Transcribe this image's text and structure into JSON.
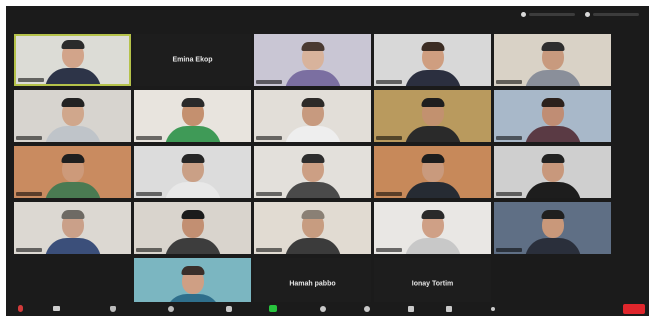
{
  "window": {
    "background": "#1b1b1b",
    "active_border": "#b5c24a"
  },
  "topbar": {
    "items": [
      {
        "icon": "view-icon"
      },
      {
        "icon": "fullscreen-icon"
      }
    ]
  },
  "tiles": [
    {
      "kind": "video",
      "active": true,
      "wall": "#dcdcd6",
      "skin": "#d2a48a",
      "hair": "#2b2b2b",
      "shirt": "#2d3448"
    },
    {
      "kind": "name",
      "name": "Emina Ekop"
    },
    {
      "kind": "video",
      "wall": "#c9c6d4",
      "skin": "#d8b39c",
      "hair": "#4a3a32",
      "shirt": "#7b6fa1"
    },
    {
      "kind": "video",
      "wall": "#d8d8d8",
      "skin": "#cf9e80",
      "hair": "#3b2c23",
      "shirt": "#2b2f3f"
    },
    {
      "kind": "video",
      "wall": "#d9d2c6",
      "skin": "#c89a7e",
      "hair": "#2e2e2e",
      "shirt": "#8a8f9a"
    },
    {
      "kind": "video",
      "wall": "#d7d4cf",
      "skin": "#d0a78c",
      "hair": "#222222",
      "shirt": "#bfc4c9"
    },
    {
      "kind": "video",
      "wall": "#e8e4de",
      "skin": "#c4906f",
      "hair": "#2a2a2a",
      "shirt": "#3f9a57"
    },
    {
      "kind": "video",
      "wall": "#e2ded8",
      "skin": "#c79a7f",
      "hair": "#2c2a28",
      "shirt": "#eeeeee"
    },
    {
      "kind": "video",
      "wall": "#b99a5e",
      "skin": "#c2916f",
      "hair": "#1e1e1e",
      "shirt": "#2a2a2a"
    },
    {
      "kind": "video",
      "wall": "#a8b8c9",
      "skin": "#c08d74",
      "hair": "#2c211c",
      "shirt": "#5a3a44"
    },
    {
      "kind": "video",
      "wall": "#c98b60",
      "skin": "#cd9a7a",
      "hair": "#1f1f1f",
      "shirt": "#4a7a52"
    },
    {
      "kind": "video",
      "wall": "#dcdcdc",
      "skin": "#caa086",
      "hair": "#262626",
      "shirt": "#e8e8e8"
    },
    {
      "kind": "video",
      "wall": "#e3e0db",
      "skin": "#cc9f84",
      "hair": "#2d2d2d",
      "shirt": "#4a4a4a"
    },
    {
      "kind": "video",
      "wall": "#c7895a",
      "skin": "#c99a7d",
      "hair": "#1d1d1d",
      "shirt": "#262b33"
    },
    {
      "kind": "video",
      "wall": "#cfcfcf",
      "skin": "#c8987c",
      "hair": "#222222",
      "shirt": "#1d1d1d"
    },
    {
      "kind": "video",
      "wall": "#dcd8d2",
      "skin": "#caa089",
      "hair": "#6e6a64",
      "shirt": "#3b4f7a"
    },
    {
      "kind": "video",
      "wall": "#d9d4cd",
      "skin": "#c28f72",
      "hair": "#1b1b1b",
      "shirt": "#3d3d3d"
    },
    {
      "kind": "video",
      "wall": "#e1dbd2",
      "skin": "#c79c80",
      "hair": "#8a8075",
      "shirt": "#3b3b3b"
    },
    {
      "kind": "video",
      "wall": "#e9e7e4",
      "skin": "#cfa086",
      "hair": "#2a2a2a",
      "shirt": "#c8c8c8"
    },
    {
      "kind": "video",
      "wall": "#5f6f85",
      "skin": "#c9987a",
      "hair": "#1f1f1f",
      "shirt": "#2a2f3b"
    },
    {
      "kind": "video",
      "wall": "#7bb6c1",
      "skin": "#cf9f84",
      "hair": "#3a2f2a",
      "shirt": "#2f6f8c"
    },
    {
      "kind": "name",
      "name": "Hamah pabbo"
    },
    {
      "kind": "name",
      "name": "Ionay Tortim"
    }
  ],
  "toolbar": {
    "buttons": [
      {
        "id": "mute",
        "icon": "microphone-icon"
      },
      {
        "id": "video",
        "icon": "video-camera-icon"
      },
      {
        "id": "security",
        "icon": "shield-icon"
      },
      {
        "id": "participants",
        "icon": "participants-icon"
      },
      {
        "id": "chat",
        "icon": "chat-icon"
      },
      {
        "id": "share",
        "icon": "share-screen-icon"
      },
      {
        "id": "record",
        "icon": "record-icon"
      },
      {
        "id": "reactions",
        "icon": "smiley-icon"
      },
      {
        "id": "apps",
        "icon": "apps-icon"
      },
      {
        "id": "whiteboard",
        "icon": "whiteboard-icon"
      },
      {
        "id": "more",
        "icon": "more-icon"
      }
    ],
    "end_color": "#e0262c"
  }
}
